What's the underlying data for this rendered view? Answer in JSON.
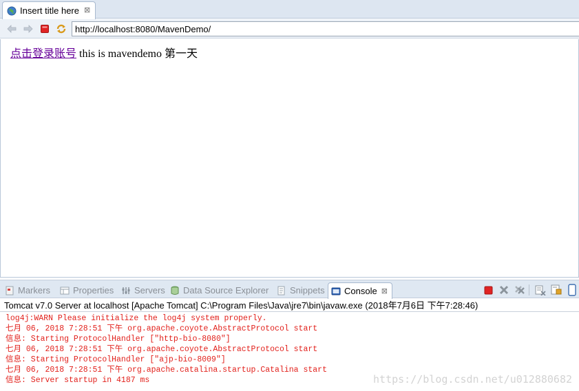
{
  "editor_tab": {
    "title": "Insert title here",
    "close_glyph": "⊠"
  },
  "browser": {
    "url": "http://localhost:8080/MavenDemo/"
  },
  "page": {
    "link_text": "点击登录账号",
    "body_text": " this is mavendemo 第一天",
    "link_color": "#660099"
  },
  "views": {
    "tabs": [
      {
        "label": "Markers",
        "icon": "markers-icon"
      },
      {
        "label": "Properties",
        "icon": "properties-icon"
      },
      {
        "label": "Servers",
        "icon": "servers-icon"
      },
      {
        "label": "Data Source Explorer",
        "icon": "data-source-icon"
      },
      {
        "label": "Snippets",
        "icon": "snippets-icon"
      },
      {
        "label": "Console",
        "icon": "console-icon",
        "active": true
      }
    ]
  },
  "console": {
    "header": "Tomcat v7.0 Server at localhost [Apache Tomcat] C:\\Program Files\\Java\\jre7\\bin\\javaw.exe (2018年7月6日 下午7:28:46)",
    "text_color": "#e2201b",
    "lines": [
      "log4j:WARN Please initialize the log4j system properly.",
      "七月 06, 2018 7:28:51 下午 org.apache.coyote.AbstractProtocol start",
      "信息: Starting ProtocolHandler [\"http-bio-8080\"]",
      "七月 06, 2018 7:28:51 下午 org.apache.coyote.AbstractProtocol start",
      "信息: Starting ProtocolHandler [\"ajp-bio-8009\"]",
      "七月 06, 2018 7:28:51 下午 org.apache.catalina.startup.Catalina start",
      "信息: Server startup in 4187 ms"
    ],
    "watermark": "https://blog.csdn.net/u012880682"
  }
}
